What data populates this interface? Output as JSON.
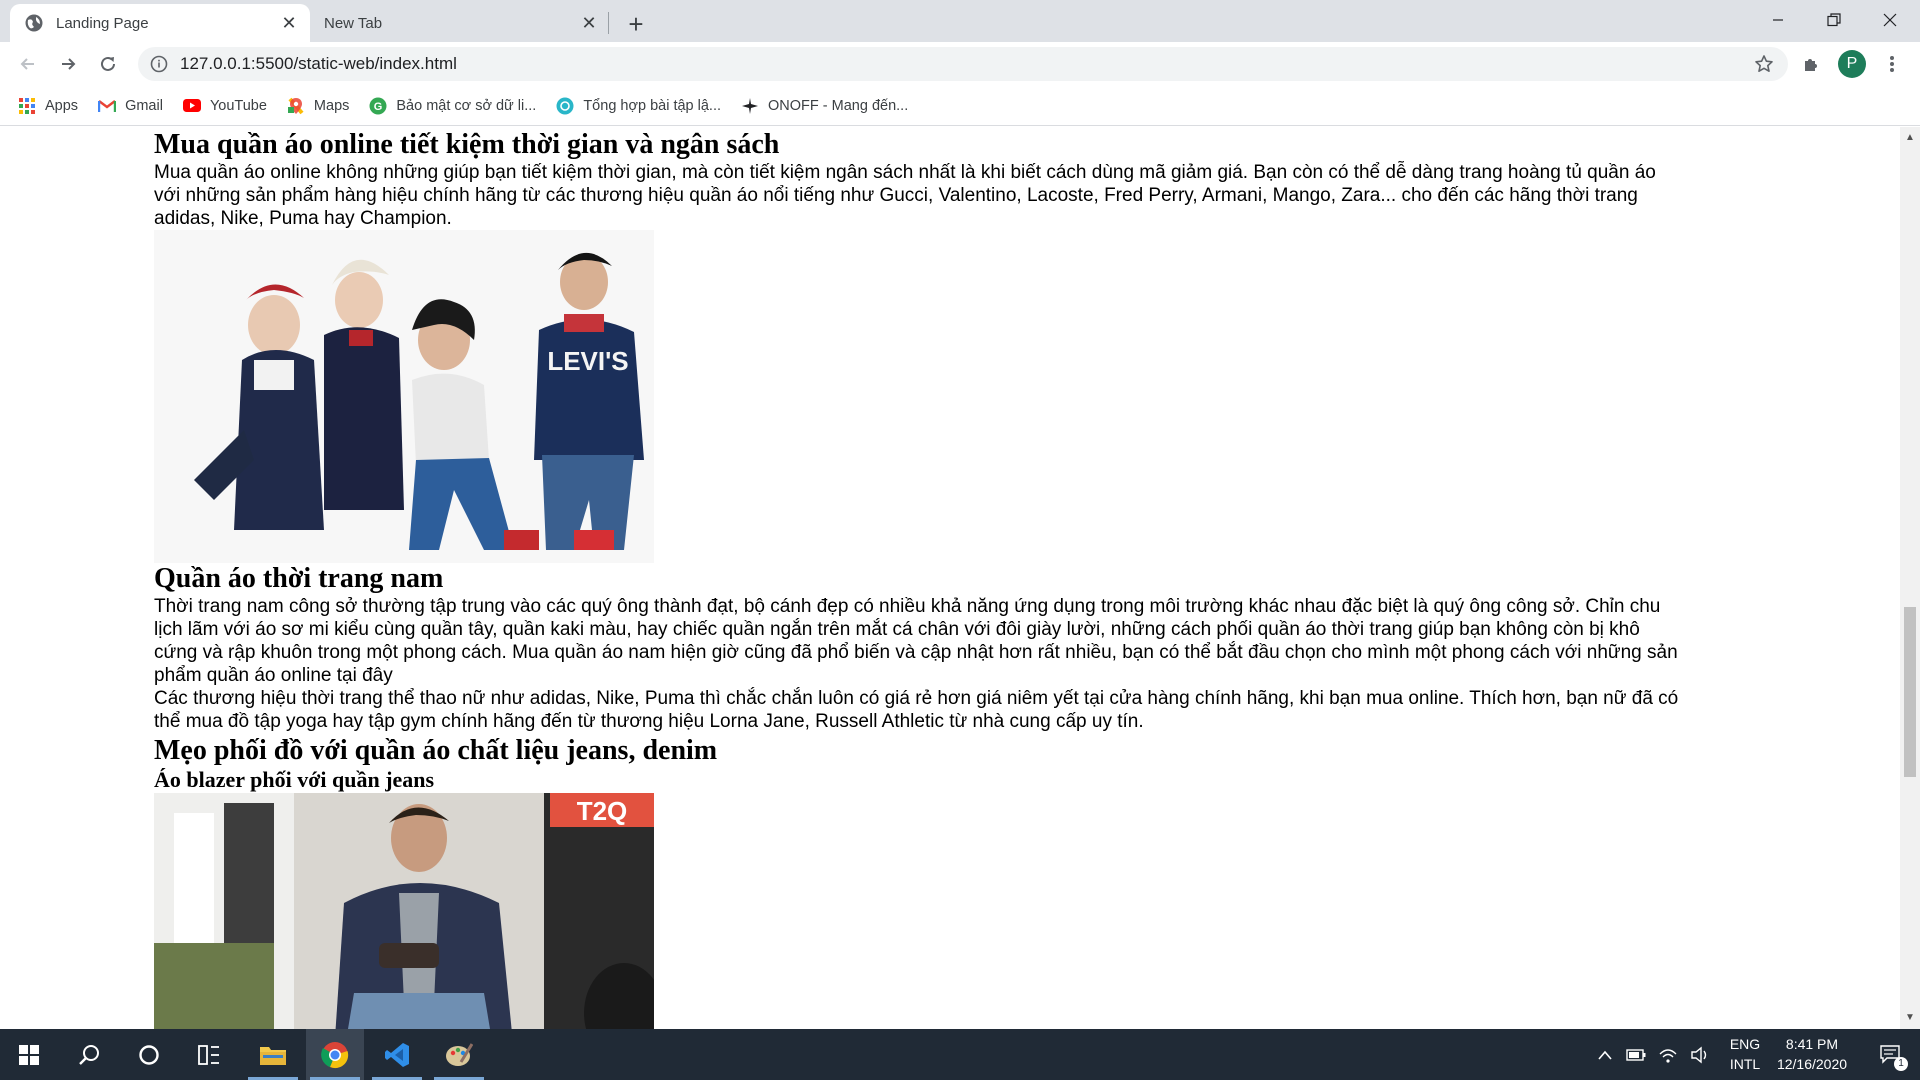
{
  "browser": {
    "tabs": [
      {
        "title": "Landing Page",
        "active": true
      },
      {
        "title": "New Tab",
        "active": false
      }
    ],
    "url": "127.0.0.1:5500/static-web/index.html",
    "profile_initial": "P",
    "accent_color": "#1e7d5a"
  },
  "bookmarks": [
    {
      "label": "Apps",
      "icon": "apps-grid-icon"
    },
    {
      "label": "Gmail",
      "icon": "gmail-icon"
    },
    {
      "label": "YouTube",
      "icon": "youtube-icon"
    },
    {
      "label": "Maps",
      "icon": "maps-icon"
    },
    {
      "label": "Bảo mật cơ sở dữ li...",
      "icon": "green-g-icon"
    },
    {
      "label": "Tổng hợp bài tập lậ...",
      "icon": "teal-circle-icon"
    },
    {
      "label": "ONOFF - Mang đến...",
      "icon": "plane-icon"
    }
  ],
  "page": {
    "h1": "Mua quần áo online tiết kiệm thời gian và ngân sách",
    "p1": "Mua quần áo online không những giúp bạn tiết kiệm thời gian, mà còn tiết kiệm ngân sách nhất là khi biết cách dùng mã giảm giá. Bạn còn có thể dễ dàng trang hoàng tủ quần áo với những sản phẩm hàng hiệu chính hãng từ các thương hiệu quần áo nổi tiếng như Gucci, Valentino, Lacoste, Fred Perry, Armani, Mango, Zara... cho đến các hãng thời trang adidas, Nike, Puma hay Champion.",
    "photo1_brand": "LEVI'S",
    "h2": "Quần áo thời trang nam",
    "p2": "Thời trang nam công sở thường tập trung vào các quý ông thành đạt, bộ cánh đẹp có nhiều khả năng ứng dụng trong môi trường khác nhau đặc biệt là quý ông công sở. Chỉn chu lịch lãm với áo sơ mi kiểu cùng quần tây, quần kaki màu, hay chiếc quần ngắn trên mắt cá chân với đôi giày lười, những cách phối quần áo thời trang giúp bạn không còn bị khô cứng và rập khuôn trong một phong cách. Mua quần áo nam hiện giờ cũng đã phổ biến và cập nhật hơn rất nhiều, bạn có thể bắt đầu chọn cho mình một phong cách với những sản phẩm quần áo online tại đây",
    "p3": "Các thương hiệu thời trang thể thao nữ như adidas, Nike, Puma thì chắc chắn luôn có giá rẻ hơn giá niêm yết tại cửa hàng chính hãng, khi bạn mua online. Thích hơn, bạn nữ đã có thể mua đồ tập yoga hay tập gym chính hãng đến từ thương hiệu Lorna Jane, Russell Athletic từ nhà cung cấp uy tín.",
    "h3": "Mẹo phối đồ với quần áo chất liệu jeans, denim",
    "h4": "Áo blazer phối với quần jeans",
    "photo2_logo": "T2Q"
  },
  "taskbar": {
    "lang_top": "ENG",
    "lang_bottom": "INTL",
    "time": "8:41 PM",
    "date": "12/16/2020",
    "notification_count": "1"
  }
}
